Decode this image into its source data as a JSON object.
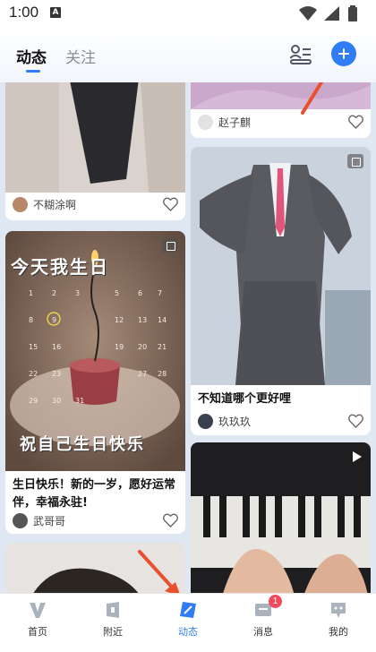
{
  "status_bar": {
    "time": "1:00",
    "indicator": "A"
  },
  "header": {
    "tabs": [
      {
        "label": "动态",
        "active": true
      },
      {
        "label": "关注",
        "active": false
      }
    ],
    "icons": [
      "contacts-icon",
      "add-icon"
    ]
  },
  "feed": {
    "left_column": [
      {
        "author": "不糊涂啊",
        "caption": ""
      },
      {
        "author": "武哥哥",
        "caption": "生日快乐！新的一岁，愿好运常伴，幸福永驻!",
        "image_text_top": "今天我生日",
        "image_text_bottom": "祝自己生日快乐"
      }
    ],
    "right_column": [
      {
        "author": "赵子麒",
        "caption": ""
      },
      {
        "author": "玖玖玖",
        "caption": "不知道哪个更好哩"
      }
    ]
  },
  "bottom_nav": [
    {
      "label": "首页",
      "icon": "home-icon",
      "active": false
    },
    {
      "label": "附近",
      "icon": "nearby-icon",
      "active": false
    },
    {
      "label": "动态",
      "icon": "moments-icon",
      "active": true
    },
    {
      "label": "消息",
      "icon": "message-icon",
      "active": false,
      "badge": "1"
    },
    {
      "label": "我的",
      "icon": "profile-icon",
      "active": false
    }
  ],
  "colors": {
    "accent": "#2f7cf6",
    "badge": "#f04a5a",
    "annotation_arrow": "#e8502e"
  }
}
